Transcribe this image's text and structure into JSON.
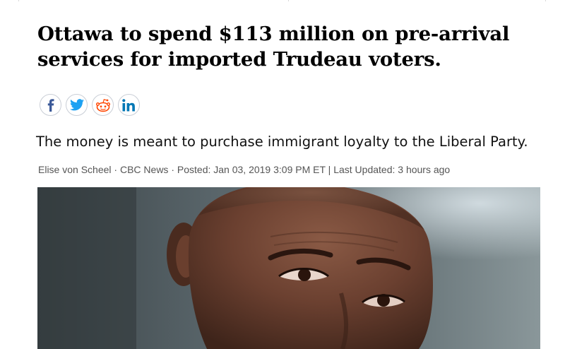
{
  "article": {
    "headline_line1": "Ottawa to spend $113 million on pre-arrival",
    "headline_line2": "services for imported Trudeau voters.",
    "subtitle": "The money is meant to purchase immigrant loyalty to the Liberal Party.",
    "byline": {
      "author": "Elise von Scheel",
      "sep1": " · ",
      "outlet": "CBC News",
      "sep2": " · ",
      "posted": "Posted: Jan 03, 2019 3:09 PM ET",
      "sep3": " | ",
      "updated": "Last Updated: 3 hours ago"
    }
  },
  "share": {
    "buttons": [
      {
        "icon": "facebook-icon",
        "color": "#3b5998"
      },
      {
        "icon": "twitter-icon",
        "color": "#1da1f2"
      },
      {
        "icon": "reddit-icon",
        "color": "#ff4500"
      },
      {
        "icon": "linkedin-icon",
        "color": "#0077b5"
      }
    ]
  },
  "photo": {
    "subject": "close-up portrait of a bald man"
  },
  "colors": {
    "headline": "#000000",
    "byline": "#555555",
    "share_border": "#c9ced6"
  }
}
